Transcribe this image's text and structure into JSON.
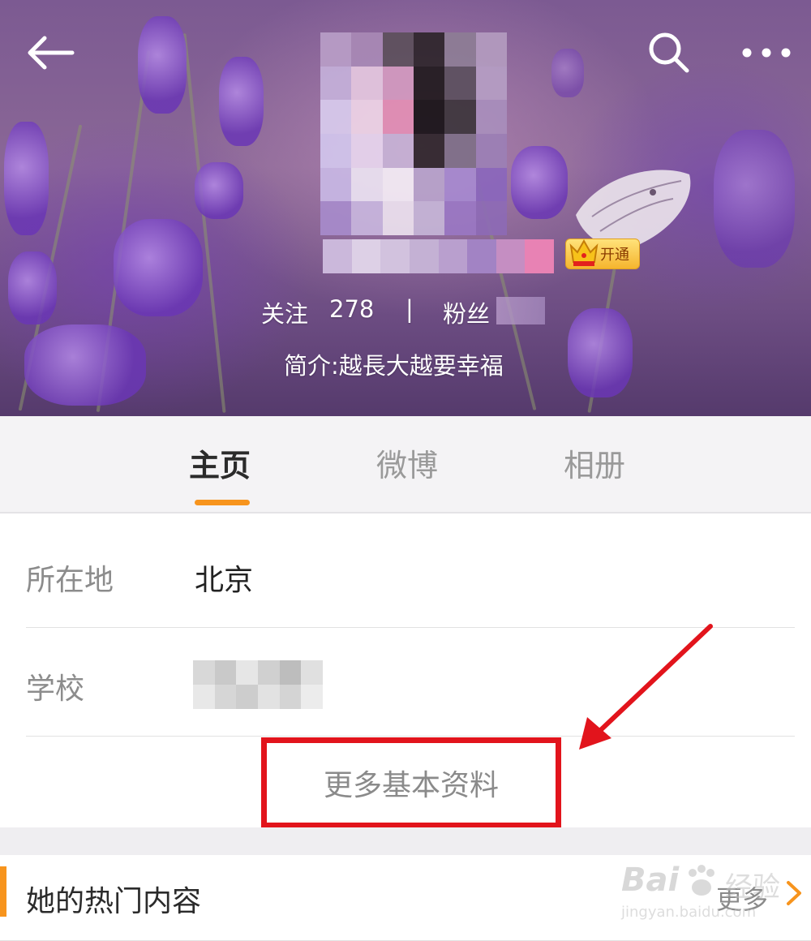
{
  "header": {
    "back_icon": "arrow-left-icon",
    "search_icon": "search-icon",
    "more_icon": "more-horizontal-icon",
    "vip_badge": "开通",
    "follow_label": "关注",
    "follow_count": "278",
    "separator": "|",
    "fans_label": "粉丝",
    "bio": "简介:越長大越要幸福"
  },
  "tabs": [
    {
      "label": "主页",
      "active": true
    },
    {
      "label": "微博",
      "active": false
    },
    {
      "label": "相册",
      "active": false
    }
  ],
  "profile_info": {
    "location_label": "所在地",
    "location_value": "北京",
    "school_label": "学校",
    "more_button": "更多基本资料"
  },
  "hot_content": {
    "title": "她的热门内容",
    "more_label": "更多",
    "chevron_icon": "chevron-right-icon"
  },
  "watermark": {
    "brand": "Bai",
    "cn": "经验",
    "url": "jingyan.baidu.com"
  },
  "colors": {
    "accent": "#f7941d",
    "annotation": "#e2141c"
  }
}
